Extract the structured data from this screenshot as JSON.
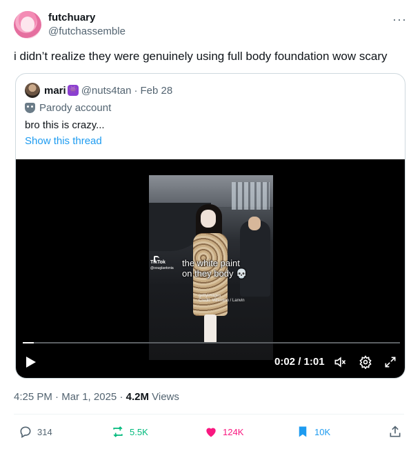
{
  "author": {
    "name": "futchuary",
    "handle": "@futchassemble"
  },
  "more_label": "···",
  "tweet_text": "i didn’t realize they were genuinely using full body foundation wow scary",
  "quote": {
    "name": "mari",
    "emoji": "👾",
    "handle": "@nuts4tan",
    "separator": "·",
    "date": "Feb 28",
    "parody_label": "Parody account",
    "text": "bro this is crazy...",
    "show_thread": "Show this thread"
  },
  "video": {
    "overlay_line1": "the white paint",
    "overlay_line2": "on they body 💀",
    "tiktok_label": "TikTok",
    "tiktok_user": "@oouglaetonia",
    "credit_line1": "gettyimages",
    "credit_line2": "Credit: Valentino / Lanvin",
    "time": "0:02 / 1:01",
    "progress": 0.03
  },
  "meta": {
    "time": "4:25 PM",
    "date": "Mar 1, 2025",
    "views_count": "4.2M",
    "views_label": "Views",
    "sep": "·"
  },
  "actions": {
    "reply": "314",
    "retweet": "5.5K",
    "like": "124K",
    "bookmark": "10K"
  },
  "colors": {
    "accent": "#1d9bf0",
    "retweet": "#00ba7c",
    "like": "#f91880",
    "muted": "#536471"
  }
}
